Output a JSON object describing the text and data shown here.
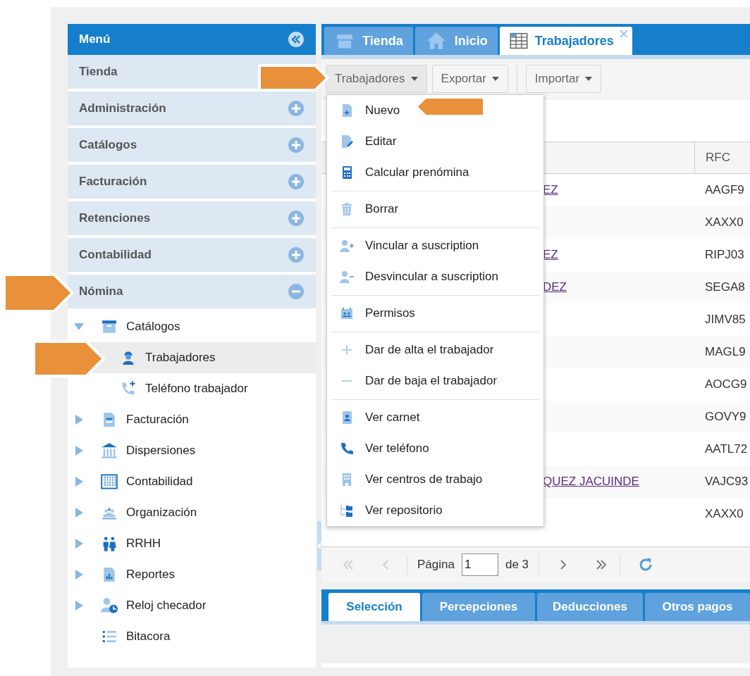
{
  "sidebar": {
    "title": "Menú",
    "sections": [
      {
        "label": "Tienda"
      },
      {
        "label": "Administración",
        "expanded": false
      },
      {
        "label": "Catálogos",
        "expanded": false
      },
      {
        "label": "Facturación",
        "expanded": false
      },
      {
        "label": "Retenciones",
        "expanded": false
      },
      {
        "label": "Contabilidad",
        "expanded": false
      },
      {
        "label": "Nómina",
        "expanded": true
      }
    ],
    "tree": [
      {
        "label": "Catálogos",
        "expanded": true,
        "selected": false,
        "children": [
          {
            "label": "Trabajadores",
            "selected": true
          },
          {
            "label": "Teléfono trabajador",
            "selected": false
          }
        ]
      },
      {
        "label": "Facturación",
        "expanded": false,
        "selected": false
      },
      {
        "label": "Dispersiones",
        "expanded": false,
        "selected": false
      },
      {
        "label": "Contabilidad",
        "expanded": false,
        "selected": false
      },
      {
        "label": "Organización",
        "expanded": false,
        "selected": false
      },
      {
        "label": "RRHH",
        "expanded": false,
        "selected": false
      },
      {
        "label": "Reportes",
        "expanded": false,
        "selected": false
      },
      {
        "label": "Reloj checador",
        "expanded": false,
        "selected": false
      },
      {
        "label": "Bitacora",
        "selected": false
      }
    ]
  },
  "tabs": [
    {
      "label": "Tienda",
      "selected": false
    },
    {
      "label": "Inicio",
      "selected": false
    },
    {
      "label": "Trabajadores",
      "selected": true,
      "closable": true
    }
  ],
  "toolbar": [
    {
      "label": "Trabajadores",
      "expanded": true
    },
    {
      "label": "Exportar",
      "expanded": false
    },
    {
      "label": "Importar",
      "expanded": false
    }
  ],
  "menu": [
    [
      "Nuevo",
      "Editar",
      "Calcular prenómina"
    ],
    [
      "Borrar"
    ],
    [
      "Vincular a suscription",
      "Desvincular a suscription"
    ],
    [
      "Permisos"
    ],
    [
      "Dar de alta el trabajador",
      "Dar de baja el trabajador"
    ],
    [
      "Ver carnet",
      "Ver teléfono",
      "Ver centros de trabajo",
      "Ver repositorio"
    ]
  ],
  "grid": {
    "columns": [
      "RFC"
    ],
    "rows": [
      {
        "link": "EZ",
        "rfc": "AAGF9"
      },
      {
        "rfc": "XAXX0"
      },
      {
        "link": "EZ",
        "rfc": "RIPJ03"
      },
      {
        "link": "DEZ",
        "rfc": "SEGA8"
      },
      {
        "rfc": "JIMV85"
      },
      {
        "rfc": "MAGL9"
      },
      {
        "rfc": "AOCG9"
      },
      {
        "rfc": "GOVY9"
      },
      {
        "rfc": "AATL72"
      },
      {
        "link": "QUEZ JACUINDE",
        "rfc": "VAJC93"
      },
      {
        "rfc": "XAXX0"
      }
    ]
  },
  "paging": {
    "page_label": "Página",
    "page": "1",
    "total_label": "de 3"
  },
  "bottom_tabs": [
    {
      "label": "Selección",
      "selected": true
    },
    {
      "label": "Percepciones",
      "selected": false
    },
    {
      "label": "Deducciones",
      "selected": false
    },
    {
      "label": "Otros pagos",
      "selected": false
    }
  ]
}
